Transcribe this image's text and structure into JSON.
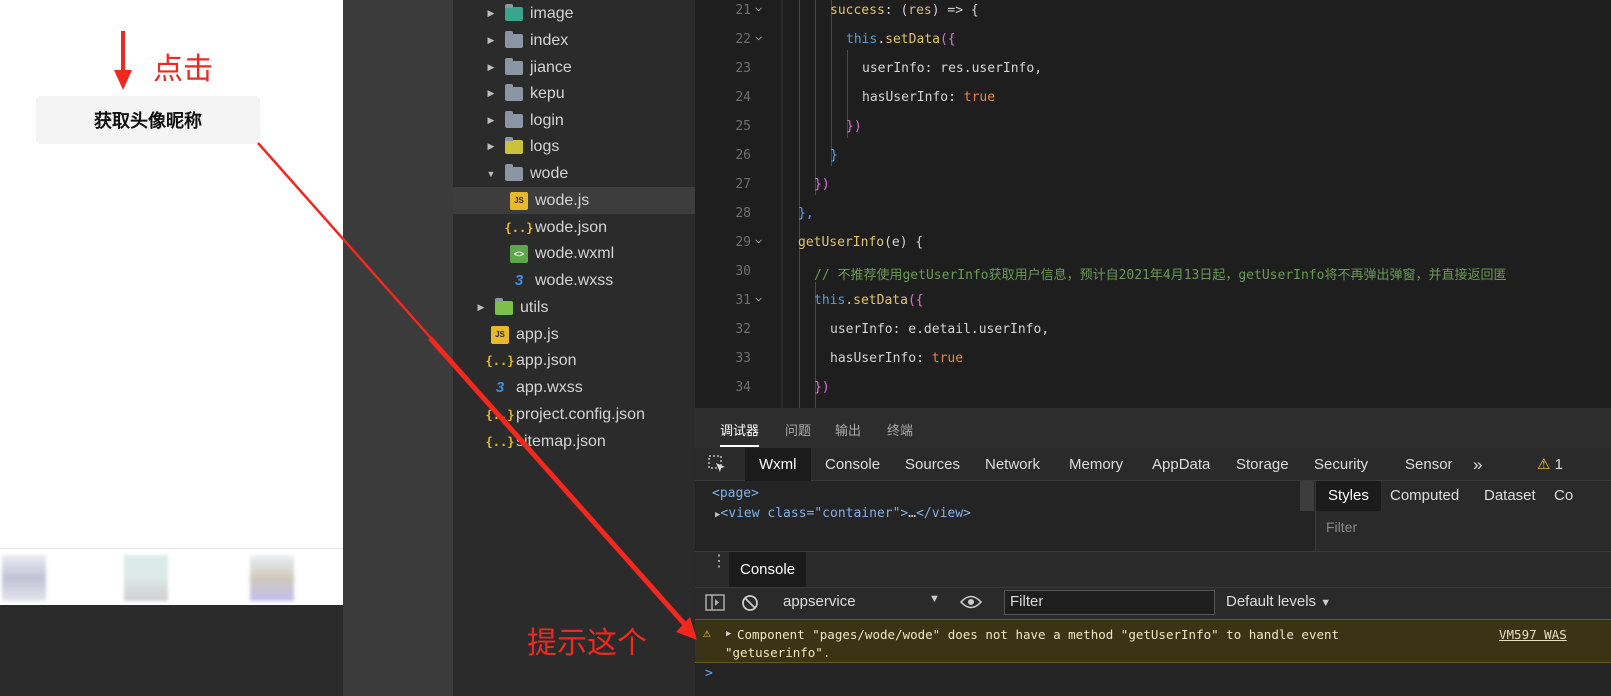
{
  "simulator": {
    "button_label": "获取头像昵称"
  },
  "annotations": {
    "click_label": "点击",
    "hint_label": "提示这个",
    "color": "#f0281e"
  },
  "file_tree": {
    "items": [
      {
        "name": "image",
        "type": "folder-image",
        "open": false
      },
      {
        "name": "index",
        "type": "folder",
        "open": false
      },
      {
        "name": "jiance",
        "type": "folder",
        "open": false
      },
      {
        "name": "kepu",
        "type": "folder",
        "open": false
      },
      {
        "name": "login",
        "type": "folder",
        "open": false
      },
      {
        "name": "logs",
        "type": "folder-logs",
        "open": false
      },
      {
        "name": "wode",
        "type": "folder",
        "open": true
      },
      {
        "name": "wode.js",
        "type": "js",
        "selected": true
      },
      {
        "name": "wode.json",
        "type": "json"
      },
      {
        "name": "wode.wxml",
        "type": "wxml"
      },
      {
        "name": "wode.wxss",
        "type": "wxss"
      },
      {
        "name": "utils",
        "type": "folder-utils",
        "open": false
      },
      {
        "name": "app.js",
        "type": "js"
      },
      {
        "name": "app.json",
        "type": "json"
      },
      {
        "name": "app.wxss",
        "type": "wxss"
      },
      {
        "name": "project.config.json",
        "type": "json"
      },
      {
        "name": "sitemap.json",
        "type": "json"
      }
    ],
    "icons": {
      "js": "JS",
      "json": "{..}",
      "wxml": "<>",
      "wxss": "3"
    }
  },
  "editor": {
    "line_numbers": [
      "21",
      "22",
      "23",
      "24",
      "25",
      "26",
      "27",
      "28",
      "29",
      "30",
      "31",
      "32",
      "33",
      "34"
    ],
    "fold_marker": "⌵",
    "lines": {
      "l21": {
        "a": "success",
        "b": ": (",
        "c": "res",
        "d": ") => {"
      },
      "l22": {
        "a": "this",
        "b": ".",
        "c": "setData",
        "d": "({"
      },
      "l23": {
        "a": "userInfo",
        "b": ": res.userInfo,"
      },
      "l24": {
        "a": "hasUserInfo",
        "b": ": ",
        "c": "true"
      },
      "l25": "})",
      "l26": "}",
      "l27": "})",
      "l28": "},",
      "l29": {
        "a": "getUserInfo",
        "b": "(e) {"
      },
      "l30": "// 不推荐使用getUserInfo获取用户信息，预计自2021年4月13日起，getUserInfo将不再弹出弹窗，并直接返回匿",
      "l31": {
        "a": "this",
        "b": ".",
        "c": "setData",
        "d": "({"
      },
      "l32": {
        "a": "userInfo",
        "b": ": e.detail.userInfo,"
      },
      "l33": {
        "a": "hasUserInfo",
        "b": ": ",
        "c": "true"
      },
      "l34": "})"
    }
  },
  "debug_tabs": [
    "调试器",
    "问题",
    "输出",
    "终端"
  ],
  "devtools": {
    "tabs": [
      "Wxml",
      "Console",
      "Sources",
      "Network",
      "Memory",
      "AppData",
      "Storage",
      "Security",
      "Sensor"
    ],
    "more": "»",
    "warning_count": "1",
    "wxml_tree": {
      "line1": "<page>",
      "line2_open": "<view class=\"container\">",
      "line2_ellipsis": "…",
      "line2_close": "</view>"
    },
    "styles_tabs": [
      "Styles",
      "Computed",
      "Dataset",
      "Co"
    ],
    "styles_filter": "Filter"
  },
  "console": {
    "title": "Console",
    "context": "appservice",
    "filter_placeholder": "Filter",
    "levels": "Default levels",
    "warning": {
      "text_line1": "Component \"pages/wode/wode\" does not have a method \"getUserInfo\" to handle event",
      "text_line2": "\"getuserinfo\".",
      "source": "VM597 WAS"
    },
    "prompt": ">"
  }
}
